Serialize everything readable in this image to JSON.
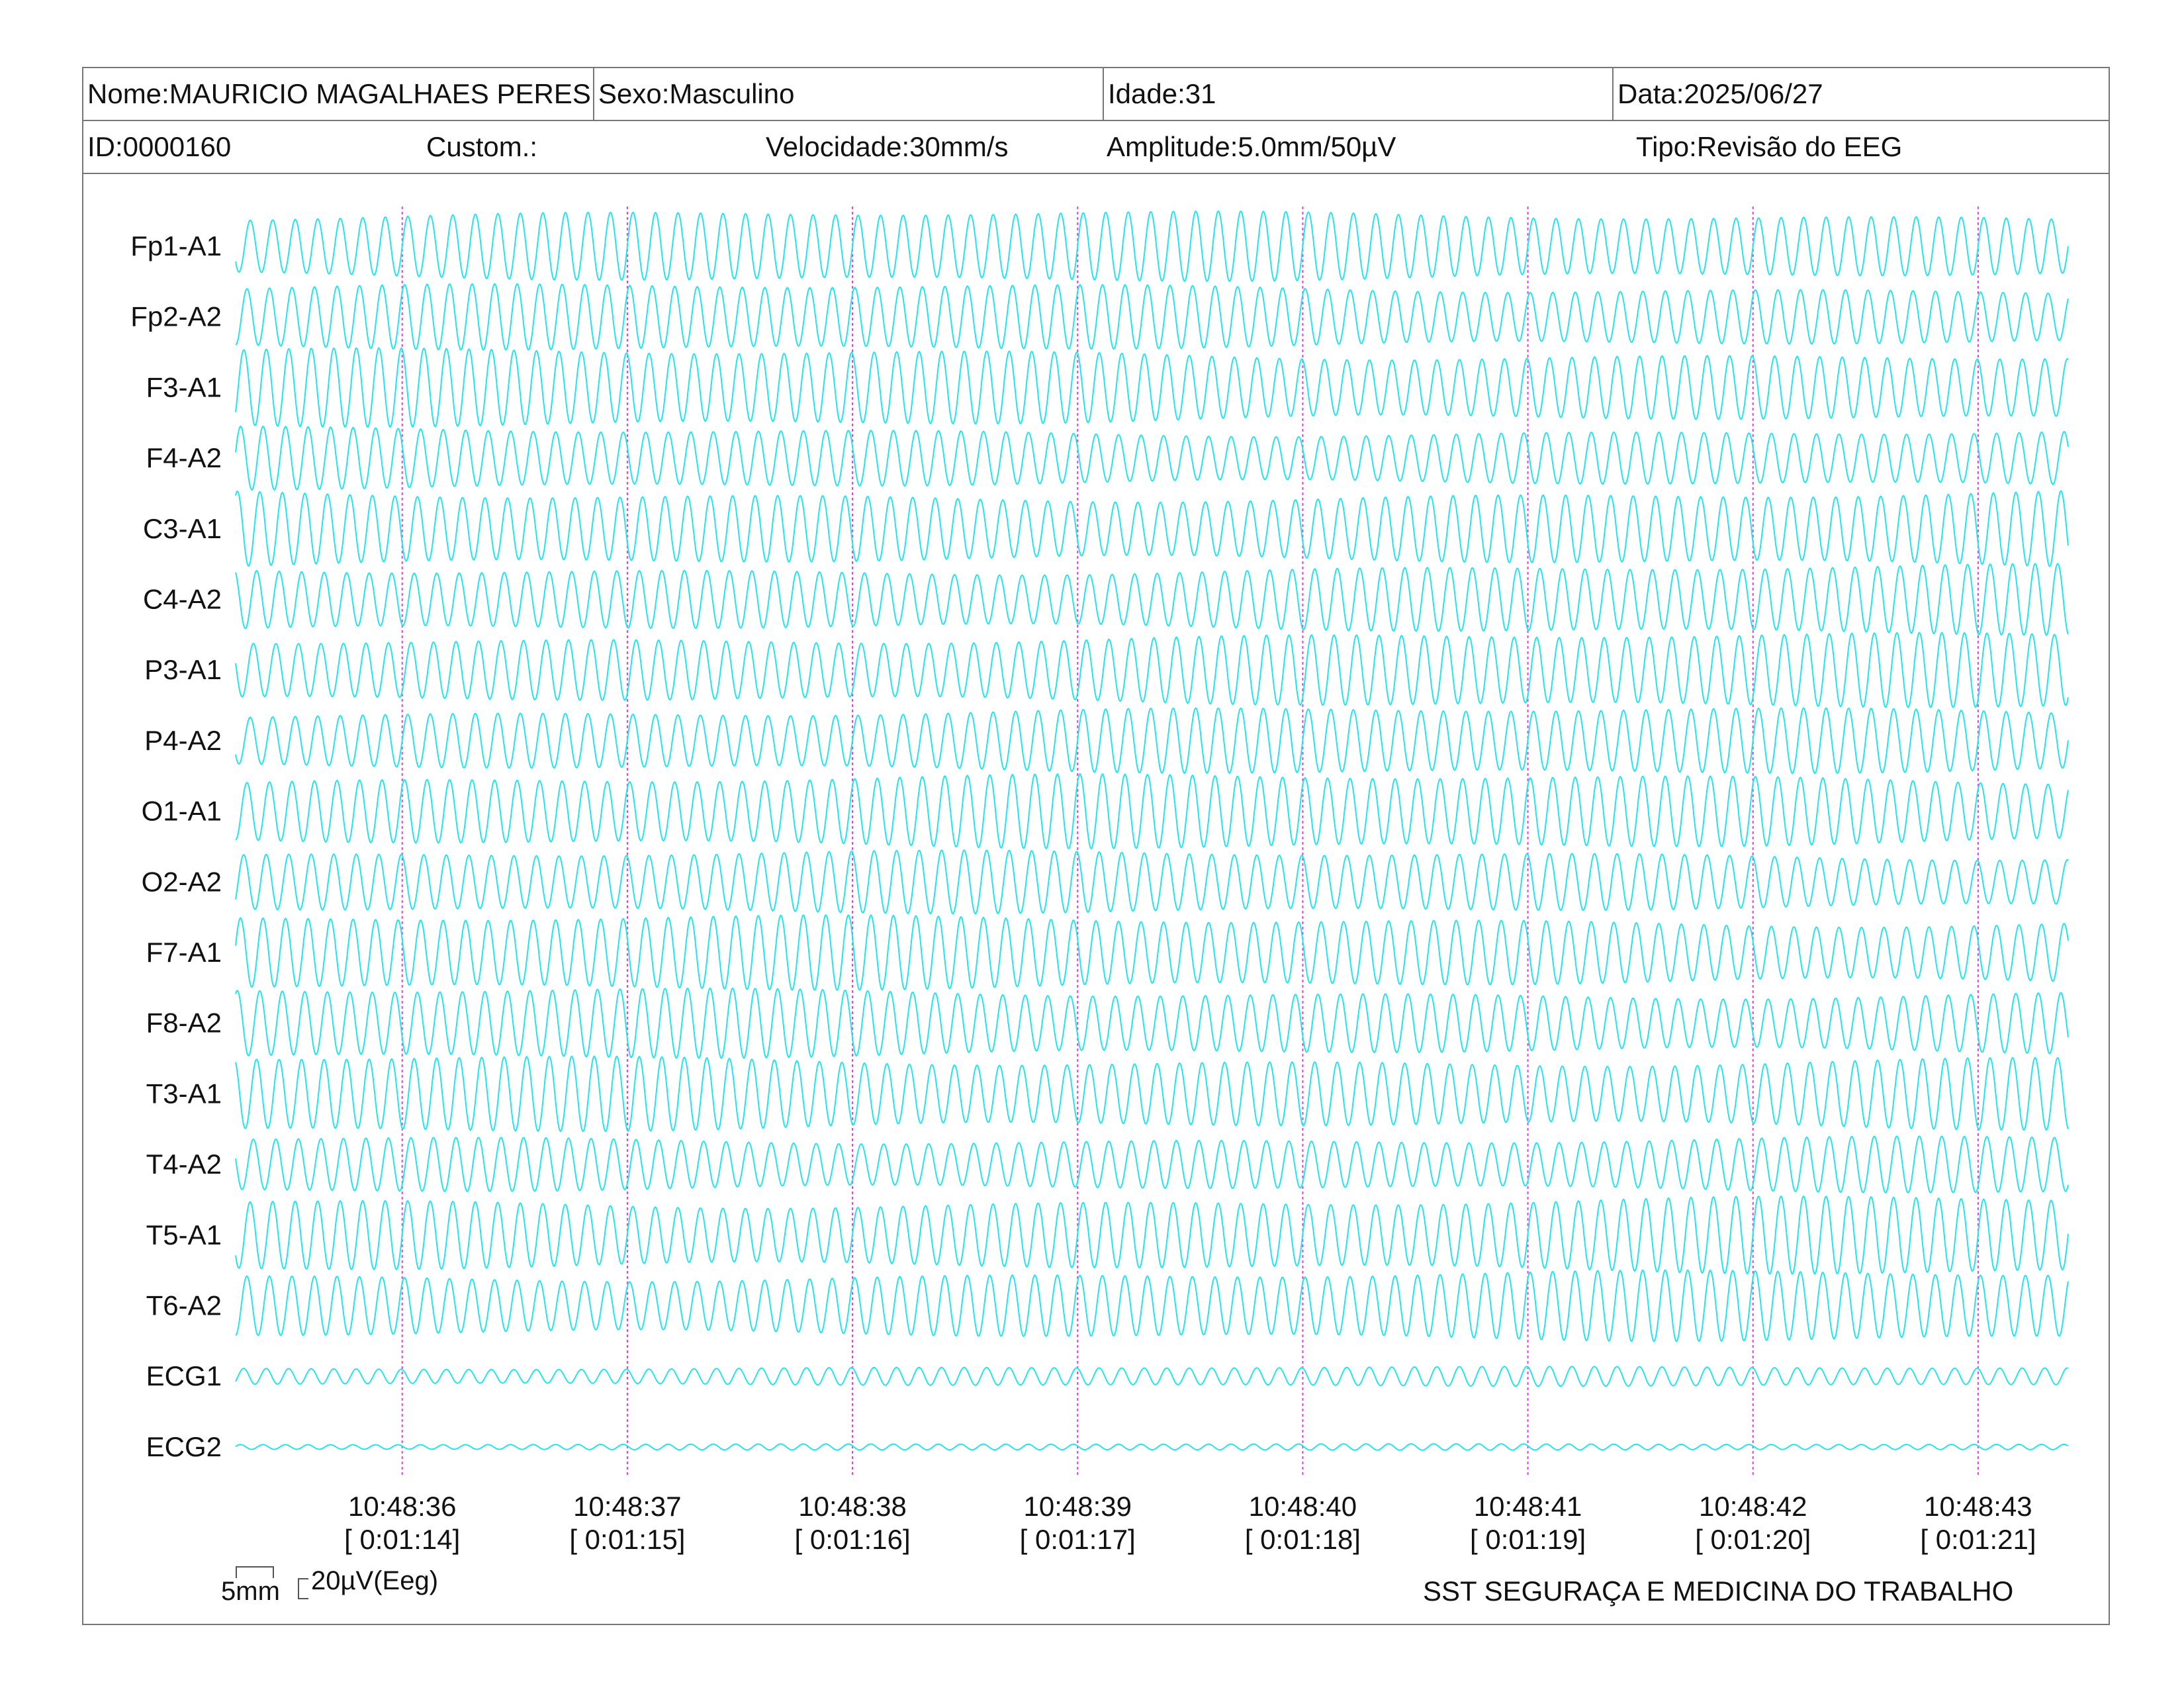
{
  "header": {
    "nome": "Nome:MAURICIO MAGALHAES PERES",
    "sexo": "Sexo:Masculino",
    "idade": "Idade:31",
    "data": "Data:2025/06/27",
    "id": "ID:0000160",
    "custom": "Custom.:",
    "velocidade": "Velocidade:30mm/s",
    "amplitude": "Amplitude:5.0mm/50µV",
    "tipo": "Tipo:Revisão do EEG"
  },
  "scale": {
    "mm_label": "5mm",
    "uv_label": "20µV(Eeg)"
  },
  "footer": "SST SEGURAÇA E MEDICINA DO TRABALHO",
  "colors": {
    "trace": "#22e4ee",
    "marker": "#e040e0"
  },
  "chart_data": {
    "type": "line",
    "title": "",
    "xlabel": "",
    "ylabel": "",
    "grid": false,
    "channels": [
      "Fp1-A1",
      "Fp2-A2",
      "F3-A1",
      "F4-A2",
      "C3-A1",
      "C4-A2",
      "P3-A1",
      "P4-A2",
      "O1-A1",
      "O2-A2",
      "F7-A1",
      "F8-A2",
      "T3-A1",
      "T4-A2",
      "T5-A1",
      "T6-A2",
      "ECG1",
      "ECG2"
    ],
    "amplitude_uv": [
      90,
      85,
      100,
      80,
      100,
      90,
      95,
      85,
      95,
      80,
      95,
      90,
      100,
      75,
      100,
      90,
      25,
      8
    ],
    "cycles_per_second": 10,
    "time_ticks": [
      "10:48:36",
      "10:48:37",
      "10:48:38",
      "10:48:39",
      "10:48:40",
      "10:48:41",
      "10:48:42",
      "10:48:43"
    ],
    "elapsed_ticks": [
      "[ 0:01:14]",
      "[ 0:01:15]",
      "[ 0:01:16]",
      "[ 0:01:17]",
      "[ 0:01:18]",
      "[ 0:01:19]",
      "[ 0:01:20]",
      "[ 0:01:21]"
    ],
    "xlim_seconds": [
      -0.74,
      7.4
    ]
  }
}
